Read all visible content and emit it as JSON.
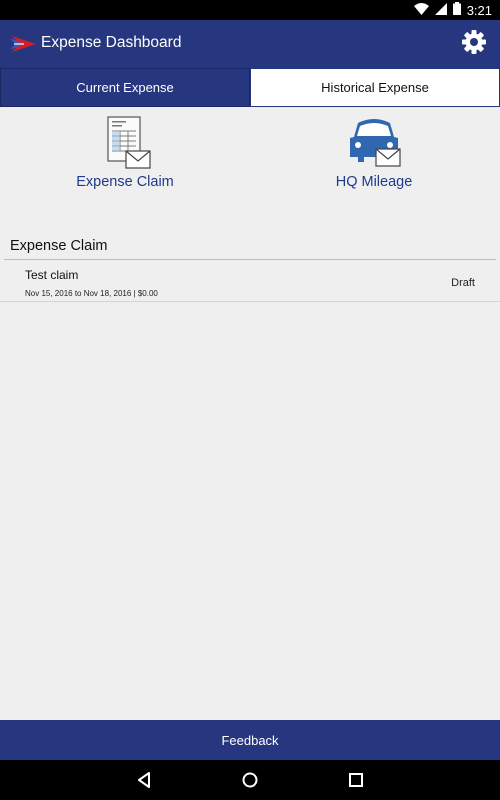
{
  "status_bar": {
    "time": "3:21",
    "icons": [
      "wifi-icon",
      "signal-icon",
      "battery-icon"
    ]
  },
  "app_bar": {
    "title": "Expense Dashboard",
    "logo": "arrow-logo",
    "settings_icon": "gear-icon"
  },
  "tabs": [
    {
      "label": "Current Expense",
      "active": true
    },
    {
      "label": "Historical Expense",
      "active": false
    }
  ],
  "tiles": [
    {
      "label": "Expense Claim",
      "icon": "document-mail-icon"
    },
    {
      "label": "HQ Mileage",
      "icon": "car-mail-icon"
    }
  ],
  "section": {
    "title": "Expense Claim",
    "items": [
      {
        "title": "Test claim",
        "subtitle": "Nov 15, 2016 to Nov 18, 2016 | $0.00",
        "status": "Draft"
      }
    ]
  },
  "footer": {
    "label": "Feedback"
  },
  "nav": [
    "back-icon",
    "home-icon",
    "recents-icon"
  ],
  "colors": {
    "primary": "#26367f",
    "background": "#efefef",
    "link_text": "#1f3a8a",
    "icon_blue": "#2f67b1"
  }
}
